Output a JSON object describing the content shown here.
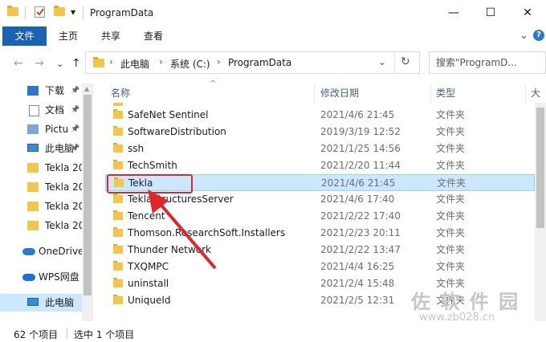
{
  "window": {
    "title": "ProgramData",
    "minimize": "—",
    "maximize": "☐",
    "close": "✕",
    "quick_access_dropdown": "▾"
  },
  "ribbon": {
    "tabs": [
      "文件",
      "主页",
      "共享",
      "查看"
    ],
    "expand": "⌄",
    "help": "?"
  },
  "navigation": {
    "back": "←",
    "forward": "→",
    "recent": "⌄",
    "up": "↑",
    "breadcrumb": [
      "此电脑",
      "系统 (C:)",
      "ProgramData"
    ],
    "separator": "›",
    "dropdown": "⌄",
    "refresh": "↻",
    "search_placeholder": "搜索\"ProgramD..."
  },
  "sidebar": {
    "items": [
      {
        "label": "下载",
        "icon": "download-icon",
        "pinned": true
      },
      {
        "label": "文档",
        "icon": "document-icon",
        "pinned": true
      },
      {
        "label": "Pictu",
        "icon": "pictures-icon",
        "pinned": true
      },
      {
        "label": "此电脑",
        "icon": "computer-icon",
        "pinned": true
      },
      {
        "label": "Tekla 20",
        "icon": "folder-icon"
      },
      {
        "label": "Tekla 20",
        "icon": "folder-icon"
      },
      {
        "label": "Tekla 20",
        "icon": "folder-icon"
      },
      {
        "label": "Tekla 20",
        "icon": "folder-icon"
      },
      {
        "label": "OneDrive",
        "icon": "cloud-icon"
      },
      {
        "label": "WPS网盘",
        "icon": "wps-cloud-icon"
      },
      {
        "label": "此电脑",
        "icon": "computer-icon",
        "selected": true
      }
    ],
    "pin_glyph": "📌"
  },
  "columns": {
    "name": "名称",
    "date": "修改日期",
    "type": "类型",
    "size": "大"
  },
  "files": [
    {
      "name": "SafeNet Sentinel",
      "date": "2021/4/6 21:45",
      "type": "文件夹"
    },
    {
      "name": "SoftwareDistribution",
      "date": "2019/3/19 12:52",
      "type": "文件夹"
    },
    {
      "name": "ssh",
      "date": "2021/1/25 14:56",
      "type": "文件夹"
    },
    {
      "name": "TechSmith",
      "date": "2021/2/20 11:44",
      "type": "文件夹"
    },
    {
      "name": "Tekla",
      "date": "2021/4/6 21:45",
      "type": "文件夹",
      "selected": true
    },
    {
      "name": "TeklaStructuresServer",
      "date": "2021/4/6 17:40",
      "type": "文件夹"
    },
    {
      "name": "Tencent",
      "date": "2021/2/22 17:40",
      "type": "文件夹"
    },
    {
      "name": "Thomson.ResearchSoft.Installers",
      "date": "2021/2/23 20:11",
      "type": "文件夹"
    },
    {
      "name": "Thunder Network",
      "date": "2021/2/22 13:47",
      "type": "文件夹"
    },
    {
      "name": "TXQMPC",
      "date": "2021/4/4 16:25",
      "type": "文件夹"
    },
    {
      "name": "uninstall",
      "date": "2021/2/4 15:48",
      "type": "文件夹"
    },
    {
      "name": "UniqueId",
      "date": "2021/2/5 12:31",
      "type": "文件夹"
    }
  ],
  "status": {
    "count": "62 个项目",
    "selected": "选中 1 个项目"
  },
  "watermark": {
    "line1": "佐 软 件 园",
    "line2": "www.zb028.cn"
  },
  "colors": {
    "file_tab": "#1a62b4",
    "selection_fill": "#cce8ff",
    "selection_border": "#99d1ff",
    "annotation_red": "#e0262b",
    "folder": "#f3c64a"
  }
}
